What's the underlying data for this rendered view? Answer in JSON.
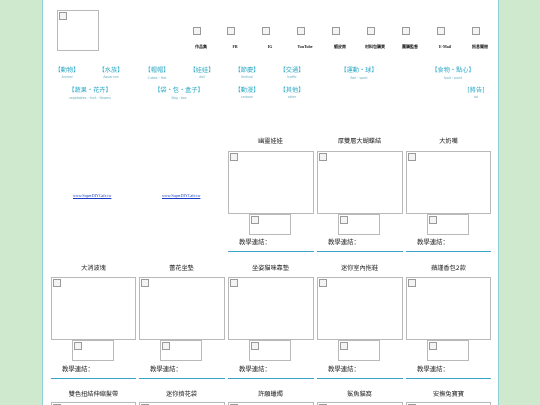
{
  "nav": [
    {
      "label": "作品集",
      "icon": "portfolio-icon"
    },
    {
      "label": "FB",
      "icon": "facebook-icon"
    },
    {
      "label": "IG",
      "icon": "instagram-icon"
    },
    {
      "label": "YouTube",
      "icon": "youtube-icon"
    },
    {
      "label": "蝦皮商",
      "icon": "shopee-icon"
    },
    {
      "label": "材料包購買",
      "icon": "material-kit-icon"
    },
    {
      "label": "團購監督",
      "icon": "group-buy-icon"
    },
    {
      "label": "E-Mail",
      "icon": "email-icon"
    },
    {
      "label": "訊息關閉",
      "icon": "message-icon"
    }
  ],
  "categories": [
    {
      "zh": "【動物】",
      "en": "Animal"
    },
    {
      "zh": "【水族】",
      "en": "Aquarium"
    },
    {
      "zh": "【帽帽】",
      "en": "Cubes・Hat"
    },
    {
      "zh": "【娃娃】",
      "en": "doll"
    },
    {
      "zh": "【節慶】",
      "en": "festival"
    },
    {
      "zh": "【交通】",
      "en": "traffic"
    },
    {
      "zh": "【運動・球】",
      "en": "Ball・sport"
    },
    {
      "zh": "【食物・點心】",
      "en": "food・point"
    },
    {
      "zh": "【蔬果・花卉】",
      "en": "vegetables・fruit・flowers"
    },
    {
      "zh": "【袋・包・盒子】",
      "en": "Bag・box"
    },
    {
      "zh": "【動漫】",
      "en": "cartoon"
    },
    {
      "zh": "【其他】",
      "en": "other"
    },
    {
      "zh": "[將告]",
      "en": "ad"
    }
  ],
  "links": [
    "www.SuperDIYCafe.tw",
    "www.SuperDIYCafe.tw"
  ],
  "row1": [
    {
      "title": "幽靈娃娃",
      "teach": "教學連結："
    },
    {
      "title": "厚雙層大蝴蝶結",
      "teach": "教學連結："
    },
    {
      "title": "大奶嘴",
      "teach": "教學連結："
    }
  ],
  "row2": [
    {
      "title": "大消波塊",
      "teach": "教學連結："
    },
    {
      "title": "蕾花坐墊",
      "teach": "教學連結："
    },
    {
      "title": "坐姿貓咪靠墊",
      "teach": "教學連結："
    },
    {
      "title": "迷你室內拖鞋",
      "teach": "教學連結："
    },
    {
      "title": "蘋謹香包2款",
      "teach": "教學連結："
    }
  ],
  "row3": [
    {
      "title": "雙色扭結伸縮髮帶"
    },
    {
      "title": "迷你擠花袋"
    },
    {
      "title": "許願蠟燭"
    },
    {
      "title": "鯊魚貓窩"
    },
    {
      "title": "安撫兔寶寶"
    }
  ],
  "colors": {
    "background": "#cfe9cf",
    "accent": "#2aa8c4",
    "divider": "#3aa3cc",
    "link": "#1a3cc8"
  }
}
